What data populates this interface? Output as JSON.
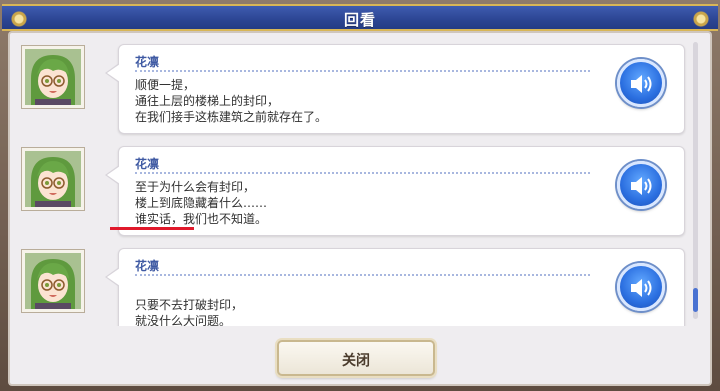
{
  "header": {
    "title": "回看"
  },
  "entries": [
    {
      "speaker": "花凛",
      "lines": [
        "顺便一提，",
        "通往上层的楼梯上的封印，",
        "在我们接手这栋建筑之前就存在了。"
      ]
    },
    {
      "speaker": "花凛",
      "lines": [
        "至于为什么会有封印，",
        "楼上到底隐藏着什么……",
        "谁实话，我们也不知道。"
      ]
    },
    {
      "speaker": "花凛",
      "lines": [
        "",
        "只要不去打破封印，",
        "就没什么大问题。"
      ]
    }
  ],
  "icons": {
    "voice": "speaker-volume-icon"
  },
  "colors": {
    "accent": "#3f5aa3",
    "highlight": "#e0192b",
    "voice_button": "#2b6fe0"
  },
  "footer": {
    "close_label": "关闭"
  }
}
